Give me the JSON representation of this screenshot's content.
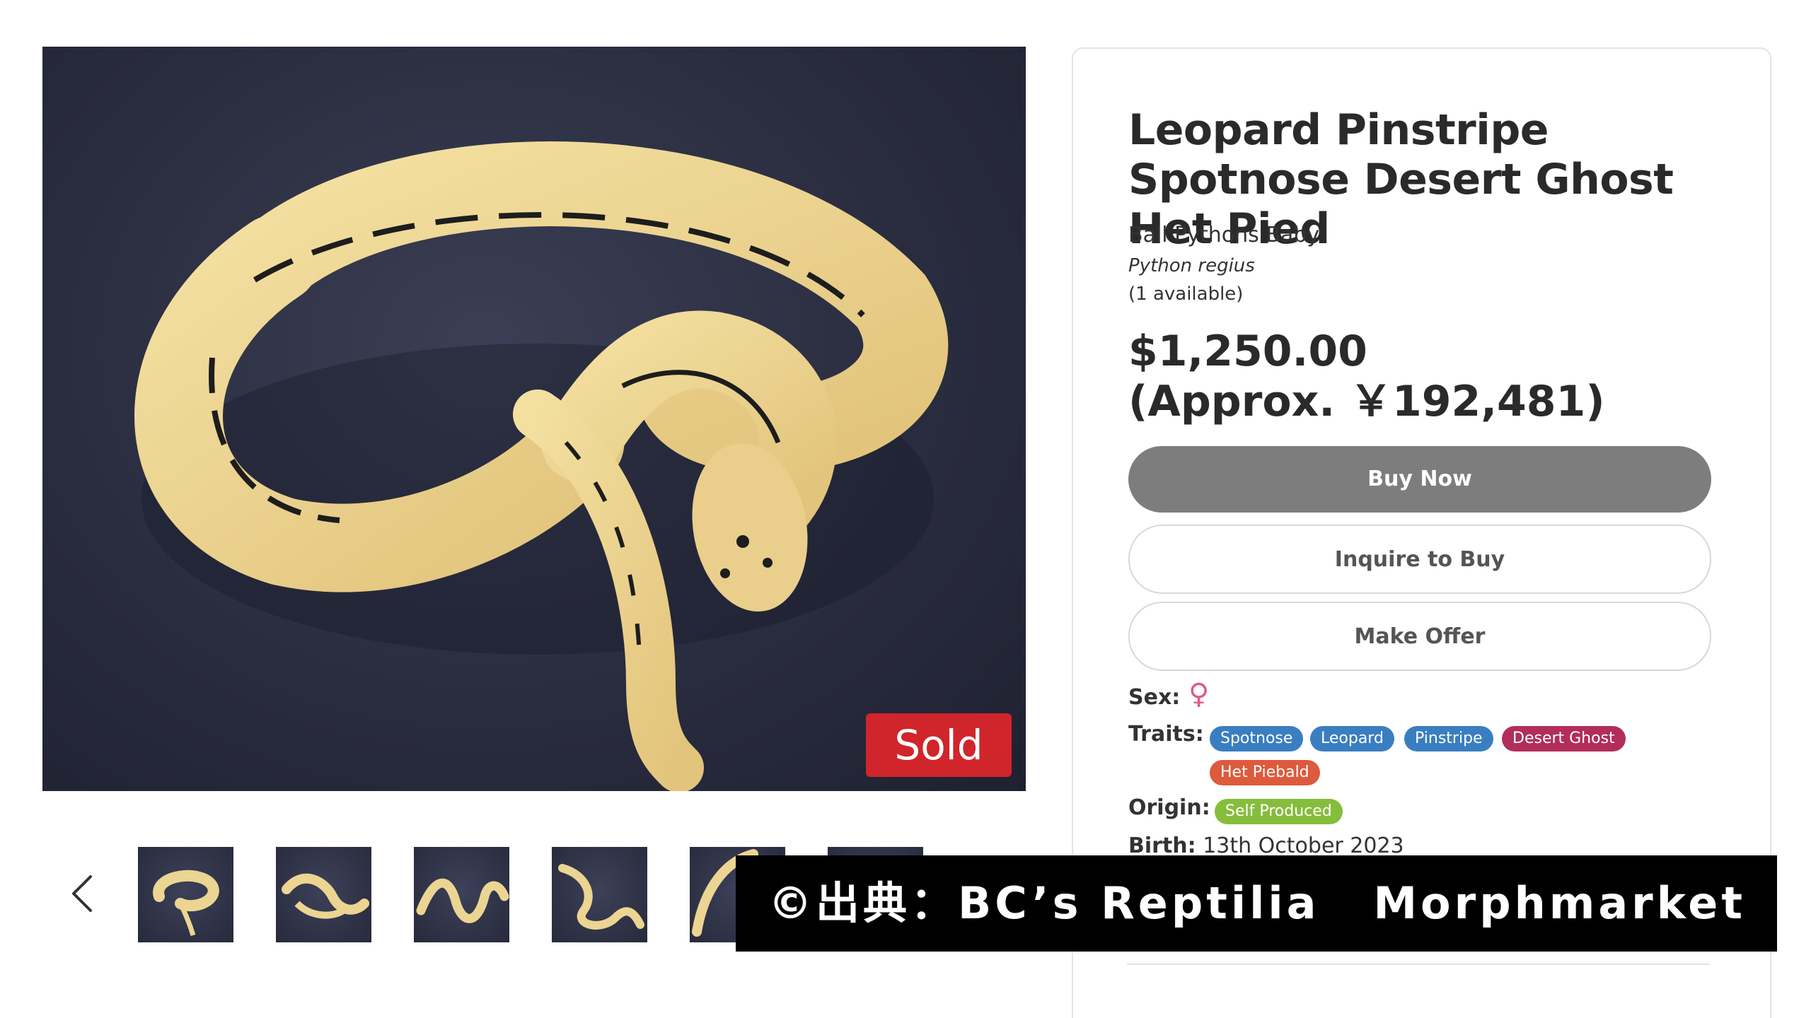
{
  "listing": {
    "title": "Leopard Pinstripe Spotnose Desert Ghost Het Pied",
    "category": "Ball Pythons Baby",
    "scientific_name": "Python regius",
    "availability": "(1 available)",
    "price": "$1,250.00",
    "price_approx": "(Approx. ￥192,481)",
    "status_badge": "Sold"
  },
  "actions": {
    "buy_now": "Buy Now",
    "inquire": "Inquire to Buy",
    "make_offer": "Make Offer"
  },
  "attributes": {
    "sex_label": "Sex:",
    "sex_value": "♀",
    "traits_label": "Traits:",
    "traits": [
      {
        "name": "Spotnose",
        "color": "#3a7ec2"
      },
      {
        "name": "Leopard",
        "color": "#3a7ec2"
      },
      {
        "name": "Pinstripe",
        "color": "#3a7ec2"
      },
      {
        "name": "Desert Ghost",
        "color": "#b22d5b"
      },
      {
        "name": "Het Piebald",
        "color": "#dd5a3d"
      }
    ],
    "origin_label": "Origin:",
    "origin_value": "Self Produced",
    "origin_color": "#86bd3c",
    "birth_label": "Birth:",
    "birth_value": "13th October 2023"
  },
  "gallery": {
    "prev_icon": "chevron-left-icon",
    "thumbnail_count": 6
  },
  "overlay": {
    "credit_left": "©出典：BC’s Reptilia",
    "credit_right": "Morphmarket"
  },
  "colors": {
    "sold_badge": "#d0252b",
    "buy_button": "#7d7d7d",
    "female_icon": "#e0598b"
  }
}
